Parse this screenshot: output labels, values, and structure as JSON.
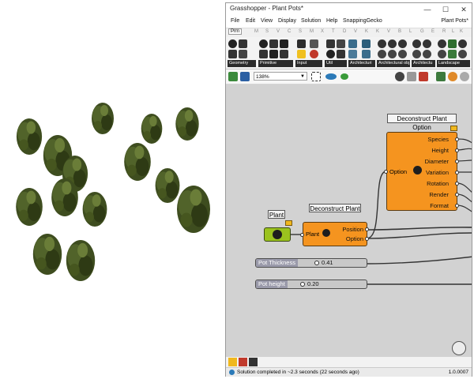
{
  "window": {
    "title": "Grasshopper - Plant Pots*",
    "document_name": "Plant Pots*",
    "controls": {
      "minimize": "—",
      "maximize": "☐",
      "close": "✕"
    }
  },
  "menu": {
    "items": [
      "File",
      "Edit",
      "View",
      "Display",
      "Solution",
      "Help",
      "SnappingGecko"
    ]
  },
  "tabs": [
    "Prm",
    "M",
    "S",
    "V",
    "C",
    "S",
    "M",
    "X",
    "T",
    "D",
    "V",
    "K",
    "K",
    "V",
    "B",
    "L",
    "G",
    "E",
    "R",
    "L",
    "K",
    "S",
    "V"
  ],
  "ribbon_groups": [
    "Geometry",
    "Primitive",
    "Input",
    "Util",
    "Architecturi",
    "Architectural obj.",
    "Architectu",
    "Landscape"
  ],
  "toolbar": {
    "zoom": "138%"
  },
  "canvas": {
    "components": {
      "plant_param": {
        "label": "Plant"
      },
      "deconstruct_plant": {
        "title": "Deconstruct Plant",
        "input": "Plant",
        "outputs": [
          "Position",
          "Option"
        ]
      },
      "deconstruct_plant_option": {
        "title": "Deconstruct Plant Option",
        "input": "Option",
        "outputs": [
          "Species",
          "Height",
          "Diameter",
          "Variation",
          "Rotation",
          "Render",
          "Format"
        ]
      }
    },
    "sliders": [
      {
        "name": "Pot Thickness",
        "value": "0.41"
      },
      {
        "name": "Pot height",
        "value": "0.20"
      }
    ]
  },
  "status": {
    "message": "Solution completed in ~2.3 seconds (22 seconds ago)",
    "version": "1.0.0007"
  },
  "colors": {
    "component_orange": "#f5941f",
    "param_green": "#9bc31e",
    "canvas_bg": "#d2d2d2",
    "tree_dark": "#3b4a1e"
  }
}
